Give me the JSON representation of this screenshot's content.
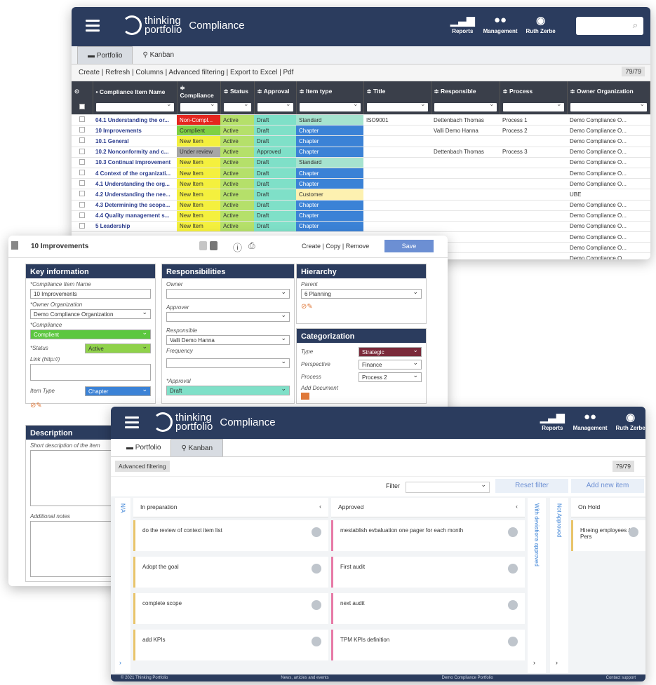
{
  "top": {
    "brand_top": "thinking",
    "brand_bottom": "portfolio",
    "app_title": "Compliance",
    "nav": [
      "Reports",
      "Management",
      "Ruth Zerbe"
    ],
    "tabs": [
      "Portfolio",
      "Kanban"
    ],
    "toolbar": "Create | Refresh | Columns | Advanced filtering | Export to Excel | Pdf",
    "count": "79/79",
    "columns": [
      "• Compliance Item Name",
      "≑ Compliance",
      "≑ Status",
      "≑ Approval",
      "≑ Item type",
      "≑ Title",
      "≑ Responsible",
      "≑ Process",
      "≑ Owner Organization"
    ],
    "rows": [
      {
        "name": "04.1 Understanding the or...",
        "compliance": "Non-Compl...",
        "cc": "c-red",
        "status": "Active",
        "approval": "Draft",
        "type": "Standard",
        "tc": "c-mint",
        "title": "ISO9001",
        "resp": "Dettenbach Thomas",
        "proc": "Process 1",
        "org": "Demo Compliance O..."
      },
      {
        "name": "10 Improvements",
        "compliance": "Complient",
        "cc": "c-green",
        "status": "Active",
        "approval": "Draft",
        "type": "Chapter",
        "tc": "c-blue",
        "title": "",
        "resp": "Valli Demo Hanna",
        "proc": "Process 2",
        "org": "Demo Compliance O..."
      },
      {
        "name": "10.1 General",
        "compliance": "New Item",
        "cc": "c-yellow",
        "status": "Active",
        "approval": "Draft",
        "type": "Chapter",
        "tc": "c-blue",
        "title": "",
        "resp": "",
        "proc": "",
        "org": "Demo Compliance O..."
      },
      {
        "name": "10.2 Nonconformity and c...",
        "compliance": "Under review",
        "cc": "c-gray",
        "status": "Active",
        "approval": "Approved",
        "type": "Chapter",
        "tc": "c-blue",
        "title": "",
        "resp": "Dettenbach Thomas",
        "proc": "Process 3",
        "org": "Demo Compliance O..."
      },
      {
        "name": "10.3 Continual improvement",
        "compliance": "New Item",
        "cc": "c-yellow",
        "status": "Active",
        "approval": "Draft",
        "type": "Standard",
        "tc": "c-mint",
        "title": "",
        "resp": "",
        "proc": "",
        "org": "Demo Compliance O..."
      },
      {
        "name": "4 Context of the organizati...",
        "compliance": "New Item",
        "cc": "c-yellow",
        "status": "Active",
        "approval": "Draft",
        "type": "Chapter",
        "tc": "c-blue",
        "title": "",
        "resp": "",
        "proc": "",
        "org": "Demo Compliance O..."
      },
      {
        "name": "4.1 Understanding the org...",
        "compliance": "New Item",
        "cc": "c-yellow",
        "status": "Active",
        "approval": "Draft",
        "type": "Chapter",
        "tc": "c-blue",
        "title": "",
        "resp": "",
        "proc": "",
        "org": "Demo Compliance O..."
      },
      {
        "name": "4.2 Understanding the nee...",
        "compliance": "New Item",
        "cc": "c-yellow",
        "status": "Active",
        "approval": "Draft",
        "type": "Customer",
        "tc": "c-cream",
        "title": "",
        "resp": "",
        "proc": "",
        "org": "UBE"
      },
      {
        "name": "4.3 Determining the scope...",
        "compliance": "New Item",
        "cc": "c-yellow",
        "status": "Active",
        "approval": "Draft",
        "type": "Chapter",
        "tc": "c-blue",
        "title": "",
        "resp": "",
        "proc": "",
        "org": "Demo Compliance O..."
      },
      {
        "name": "4.4 Quality management s...",
        "compliance": "New Item",
        "cc": "c-yellow",
        "status": "Active",
        "approval": "Draft",
        "type": "Chapter",
        "tc": "c-blue",
        "title": "",
        "resp": "",
        "proc": "",
        "org": "Demo Compliance O..."
      },
      {
        "name": "5 Leadership",
        "compliance": "New Item",
        "cc": "c-yellow",
        "status": "Active",
        "approval": "Draft",
        "type": "Chapter",
        "tc": "c-blue",
        "title": "",
        "resp": "",
        "proc": "",
        "org": "Demo Compliance O..."
      }
    ],
    "extra_org": [
      "Demo Compliance O...",
      "Demo Compliance O...",
      "Demo Compliance O..."
    ]
  },
  "detail": {
    "title": "10 Improvements",
    "actions": "Create | Copy | Remove",
    "save": "Save",
    "key_info": "Key information",
    "name_label": "*Compliance Item Name",
    "name_value": "10 Improvements",
    "org_label": "*Owner Organization",
    "org_value": "Demo Compliance Organization",
    "compliance_label": "*Compliance",
    "compliance_value": "Complient",
    "status_label": "*Status",
    "status_value": "Active",
    "link_label": "Link (http://)",
    "itemtype_label": "Item Type",
    "itemtype_value": "Chapter",
    "resp_title": "Responsibilities",
    "owner_label": "Owner",
    "approver_label": "Approver",
    "responsible_label": "Responsible",
    "responsible_value": "Valli Demo Hanna",
    "frequency_label": "Frequency",
    "approval_label": "*Approval",
    "approval_value": "Draft",
    "hier_title": "Hierarchy",
    "parent_label": "Parent",
    "parent_value": "6 Planning",
    "cat_title": "Categorization",
    "type_label": "Type",
    "type_value": "Strategic",
    "persp_label": "Perspective",
    "persp_value": "Finance",
    "process_label": "Process",
    "process_value": "Process 2",
    "adddoc_label": "Add Document",
    "desc_title": "Description",
    "desc_placeholder": "Short description of the item",
    "notes_placeholder": "Additional notes"
  },
  "kanban": {
    "brand_top": "thinking",
    "brand_bottom": "portfolio",
    "app_title": "Compliance",
    "nav": [
      "Reports",
      "Management",
      "Ruth Zerbe"
    ],
    "tabs": [
      "Portfolio",
      "Kanban"
    ],
    "adv": "Advanced filtering",
    "count": "79/79",
    "filter_label": "Filter",
    "reset": "Reset filter",
    "add": "Add new item",
    "na": "N/A",
    "col1": "In preparation",
    "col1_cards": [
      "do the review of context item list",
      "Adopt the goal",
      "complete scope",
      "add KPIs"
    ],
    "col2": "Approved",
    "col2_cards": [
      "mestablish evbaluation one pager for each month",
      "First audit",
      "next audit",
      "TPM KPIs definition"
    ],
    "vcol3": "With deviations approved",
    "vcol4": "Not Approved",
    "col5": "On Hold",
    "col5_cards": [
      "Hireing employees / Pers"
    ],
    "footer": [
      "© 2021 Thinking Portfolio",
      "News, articles and events",
      "Demo Compliance Portfolio",
      "Contact support"
    ],
    "colors": {
      "prep": "#e8c46a",
      "approved": "#e77aa6",
      "hold": "#e8c46a"
    }
  }
}
